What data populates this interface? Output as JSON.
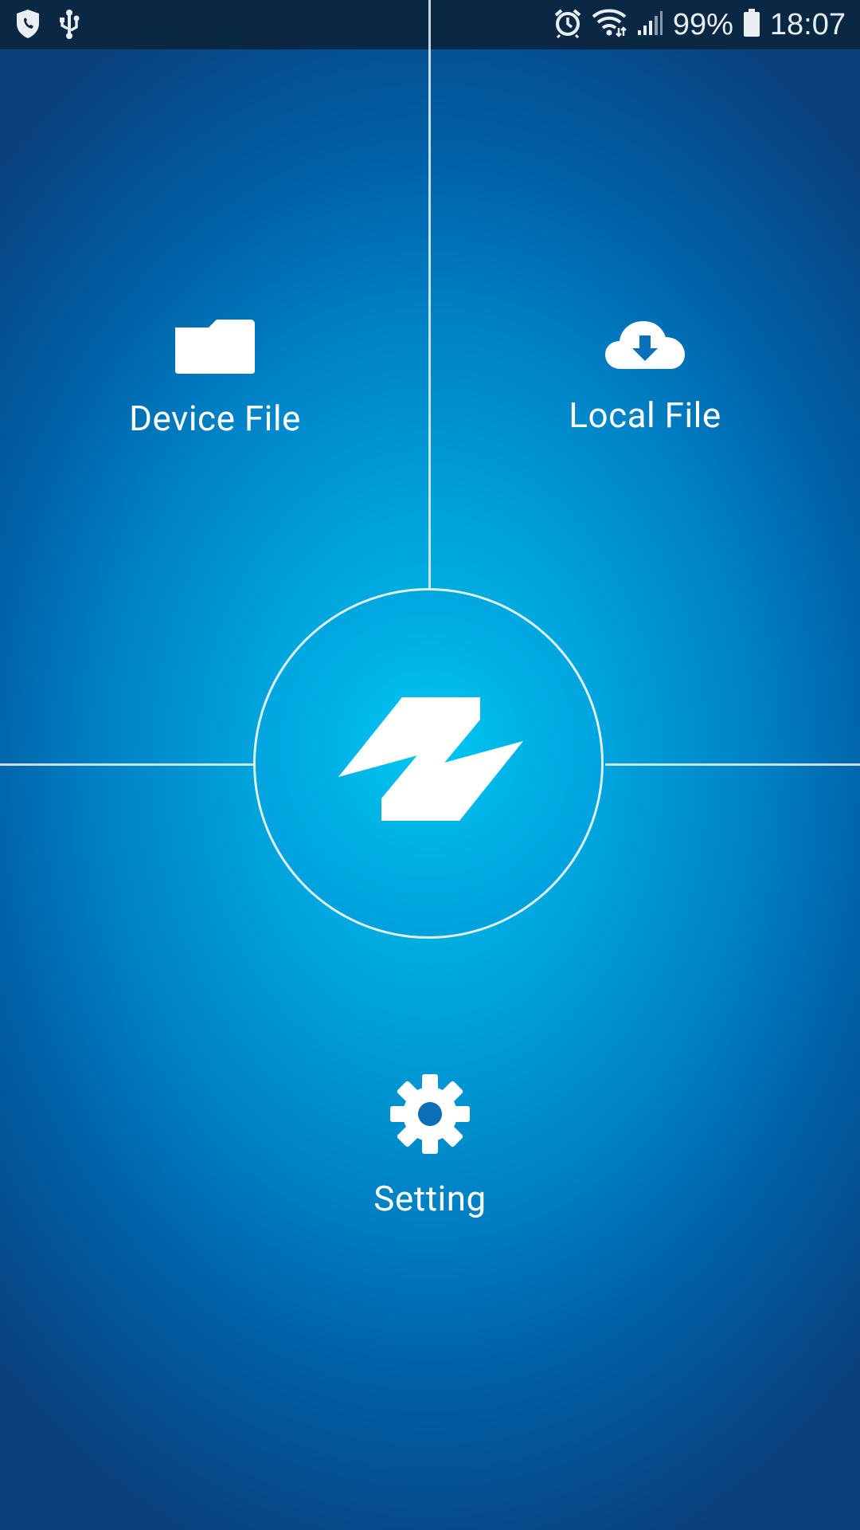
{
  "status_bar": {
    "battery_percent": "99%",
    "time": "18:07",
    "icons": [
      "shield-icon",
      "usb-icon",
      "alarm-icon",
      "wifi-icon",
      "signal-icon",
      "battery-icon"
    ]
  },
  "menu": {
    "device_file_label": "Device File",
    "device_file_icon": "folder-icon",
    "local_file_label": "Local File",
    "local_file_icon": "cloud-download-icon",
    "setting_label": "Setting",
    "setting_icon": "gear-icon"
  },
  "center": {
    "logo_icon": "app-logo-icon"
  },
  "colors": {
    "background_center": "#00c2ee",
    "background_edge": "#0a3f7c",
    "status_bar": "#0a2744",
    "foreground": "#ffffff"
  }
}
